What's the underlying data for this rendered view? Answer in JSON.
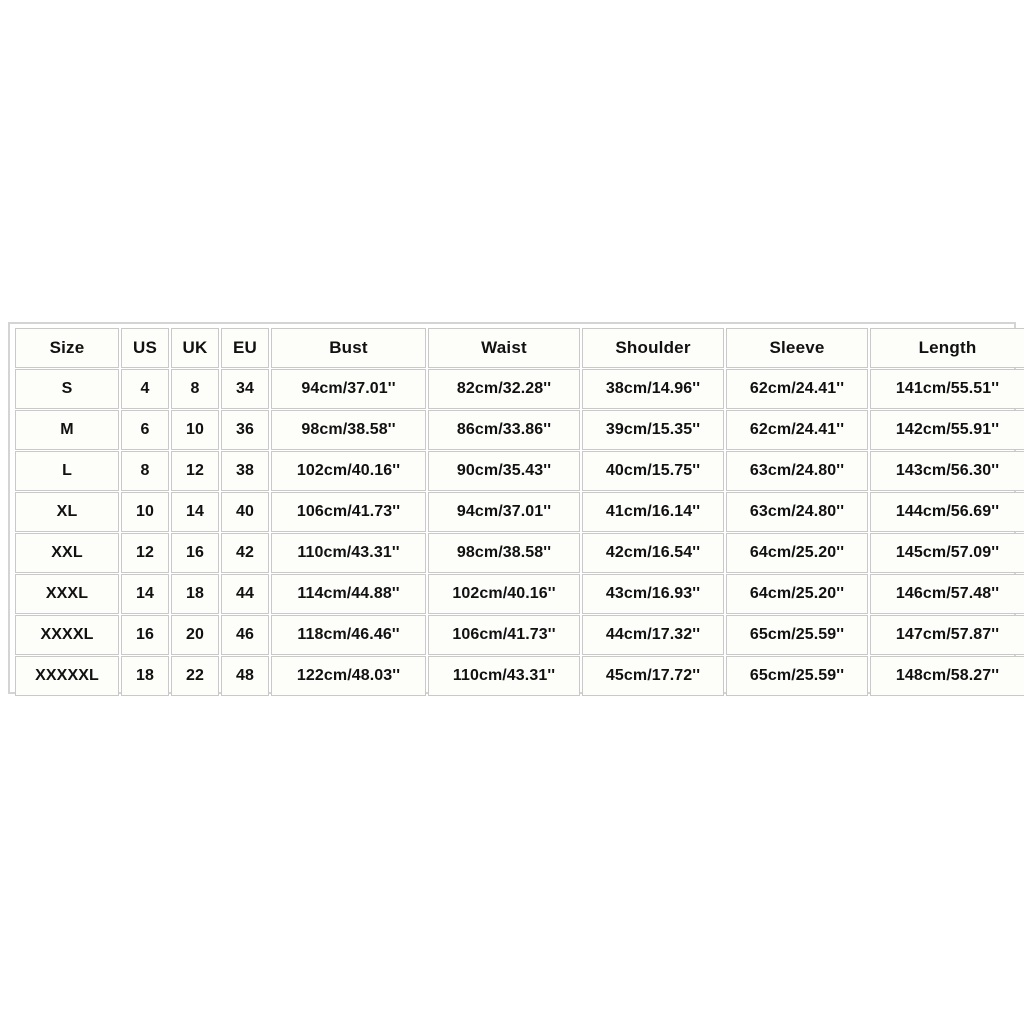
{
  "chart": {
    "columns": [
      {
        "key": "size",
        "label": "Size"
      },
      {
        "key": "us",
        "label": "US"
      },
      {
        "key": "uk",
        "label": "UK"
      },
      {
        "key": "eu",
        "label": "EU"
      },
      {
        "key": "bust",
        "label": "Bust"
      },
      {
        "key": "waist",
        "label": "Waist"
      },
      {
        "key": "shoulder",
        "label": "Shoulder"
      },
      {
        "key": "sleeve",
        "label": "Sleeve"
      },
      {
        "key": "length",
        "label": "Length"
      }
    ],
    "rows": [
      {
        "size": "S",
        "us": "4",
        "uk": "8",
        "eu": "34",
        "bust": "94cm/37.01''",
        "waist": "82cm/32.28''",
        "shoulder": "38cm/14.96''",
        "sleeve": "62cm/24.41''",
        "length": "141cm/55.51''"
      },
      {
        "size": "M",
        "us": "6",
        "uk": "10",
        "eu": "36",
        "bust": "98cm/38.58''",
        "waist": "86cm/33.86''",
        "shoulder": "39cm/15.35''",
        "sleeve": "62cm/24.41''",
        "length": "142cm/55.91''"
      },
      {
        "size": "L",
        "us": "8",
        "uk": "12",
        "eu": "38",
        "bust": "102cm/40.16''",
        "waist": "90cm/35.43''",
        "shoulder": "40cm/15.75''",
        "sleeve": "63cm/24.80''",
        "length": "143cm/56.30''"
      },
      {
        "size": "XL",
        "us": "10",
        "uk": "14",
        "eu": "40",
        "bust": "106cm/41.73''",
        "waist": "94cm/37.01''",
        "shoulder": "41cm/16.14''",
        "sleeve": "63cm/24.80''",
        "length": "144cm/56.69''"
      },
      {
        "size": "XXL",
        "us": "12",
        "uk": "16",
        "eu": "42",
        "bust": "110cm/43.31''",
        "waist": "98cm/38.58''",
        "shoulder": "42cm/16.54''",
        "sleeve": "64cm/25.20''",
        "length": "145cm/57.09''"
      },
      {
        "size": "XXXL",
        "us": "14",
        "uk": "18",
        "eu": "44",
        "bust": "114cm/44.88''",
        "waist": "102cm/40.16''",
        "shoulder": "43cm/16.93''",
        "sleeve": "64cm/25.20''",
        "length": "146cm/57.48''"
      },
      {
        "size": "XXXXL",
        "us": "16",
        "uk": "20",
        "eu": "46",
        "bust": "118cm/46.46''",
        "waist": "106cm/41.73''",
        "shoulder": "44cm/17.32''",
        "sleeve": "65cm/25.59''",
        "length": "147cm/57.87''"
      },
      {
        "size": "XXXXXL",
        "us": "18",
        "uk": "22",
        "eu": "48",
        "bust": "122cm/48.03''",
        "waist": "110cm/43.31''",
        "shoulder": "45cm/17.72''",
        "sleeve": "65cm/25.59''",
        "length": "148cm/58.27''"
      }
    ]
  },
  "colors": {
    "page_background": "#ffffff",
    "cell_background": "#fdfdfa",
    "cell_border": "#c9c9c9",
    "frame_border": "#d4d4d4",
    "text": "#111111"
  }
}
